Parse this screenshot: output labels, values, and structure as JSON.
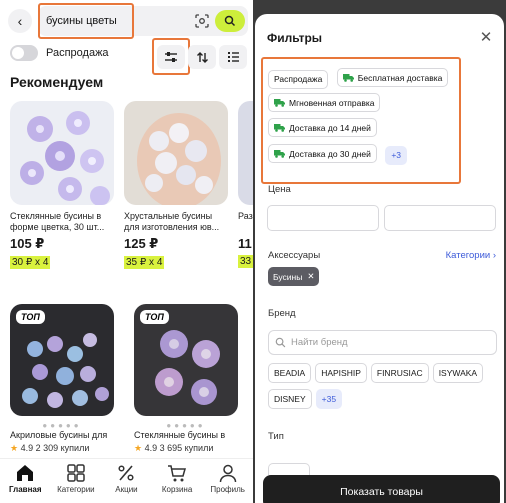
{
  "search": {
    "query": "бусины цветы"
  },
  "toggle": {
    "label": "Распродажа"
  },
  "section": {
    "title": "Рекомендуем"
  },
  "products": [
    {
      "desc": "Стеклянные бусины в форме цветка, 30 шт...",
      "price": "105 ₽",
      "installment": "30 ₽ x 4"
    },
    {
      "desc": "Хрустальные бусины для изготовления юв...",
      "price": "125 ₽",
      "installment": "35 ₽ x 4"
    },
    {
      "desc": "Раз...",
      "price": "11",
      "installment": "33"
    }
  ],
  "products_row2": [
    {
      "badge": "ТОП",
      "desc": "Акриловые бусины для ...",
      "rating": "4.9",
      "sold": "2 309 купили"
    },
    {
      "badge": "ТОП",
      "desc": "Стеклянные бусины в ф...",
      "rating": "4.9",
      "sold": "3 695 купили"
    }
  ],
  "tabbar": {
    "items": [
      {
        "label": "Главная",
        "icon": "home-icon"
      },
      {
        "label": "Категории",
        "icon": "categories-icon"
      },
      {
        "label": "Акции",
        "icon": "percent-icon"
      },
      {
        "label": "Корзина",
        "icon": "cart-icon"
      },
      {
        "label": "Профиль",
        "icon": "profile-icon"
      }
    ]
  },
  "filters": {
    "title": "Фильтры",
    "quick": {
      "sale": "Распродажа",
      "free_delivery": "Бесплатная доставка",
      "instant": "Мгновенная отправка",
      "d14": "Доставка до 14 дней",
      "d30": "Доставка до 30 дней",
      "more": "+3"
    },
    "price_label": "Цена",
    "accessories_label": "Аксессуары",
    "categories_link": "Категории",
    "selected_chip": "Бусины",
    "brand_label": "Бренд",
    "brand_placeholder": "Найти бренд",
    "brands_row1": [
      "BEADIA",
      "HAPISHIP",
      "FINRUSIAC",
      "ISYWAKA"
    ],
    "brand_disney": "DISNEY",
    "brand_more": "+35",
    "type_label": "Тип",
    "show_button": "Показать товары"
  },
  "colors": {
    "accent_green": "#cdee3b",
    "installment_bg": "#d9f23e",
    "highlight": "#e8773a",
    "link_blue": "#3d5bd9",
    "truck_green": "#2fa24a"
  }
}
